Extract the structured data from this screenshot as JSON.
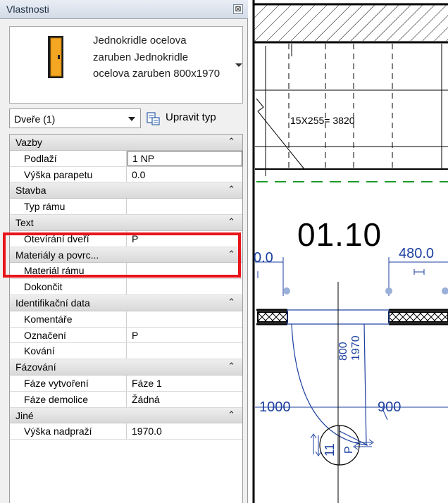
{
  "panel": {
    "title": "Vlastnosti",
    "close_symbol": "⊠",
    "type_name": "Jednokridle ocelova zaruben Jednokridle ocelova zaruben 800x1970",
    "category_select": "Dveře (1)",
    "edit_type_label": "Upravit typ"
  },
  "groups": {
    "vazby": {
      "label": "Vazby",
      "rows": [
        {
          "name": "Podlaží",
          "value": "1 NP"
        },
        {
          "name": "Výška parapetu",
          "value": "0.0"
        }
      ]
    },
    "stavba": {
      "label": "Stavba",
      "rows": [
        {
          "name": "Typ rámu",
          "value": ""
        }
      ]
    },
    "text": {
      "label": "Text",
      "rows": [
        {
          "name": "Otevírání dveří",
          "value": "P"
        }
      ]
    },
    "materialy": {
      "label": "Materiály a povrc...",
      "rows": [
        {
          "name": "Materiál rámu",
          "value": ""
        },
        {
          "name": "Dokončit",
          "value": ""
        }
      ]
    },
    "ident": {
      "label": "Identifikační data",
      "rows": [
        {
          "name": "Komentáře",
          "value": ""
        },
        {
          "name": "Označení",
          "value": "P"
        },
        {
          "name": "Kování",
          "value": ""
        }
      ]
    },
    "fazovani": {
      "label": "Fázování",
      "rows": [
        {
          "name": "Fáze vytvoření",
          "value": "Fáze 1"
        },
        {
          "name": "Fáze demolice",
          "value": "Žádná"
        }
      ]
    },
    "jine": {
      "label": "Jiné",
      "rows": [
        {
          "name": "Výška nadpraží",
          "value": "1970.0"
        }
      ]
    }
  },
  "canvas": {
    "stair_label": "15X255= 3820",
    "room_number": "01.10",
    "dim_left": "0.0",
    "dim_right": "480.0",
    "door_width": "800",
    "door_height": "1970",
    "dim_1000": "1000",
    "dim_900": "900",
    "door_tag": "11",
    "door_swing": "P"
  },
  "colors": {
    "highlight": "#e8141a",
    "annotation_blue": "#1c3fa0",
    "door_orange": "#f5a623"
  }
}
